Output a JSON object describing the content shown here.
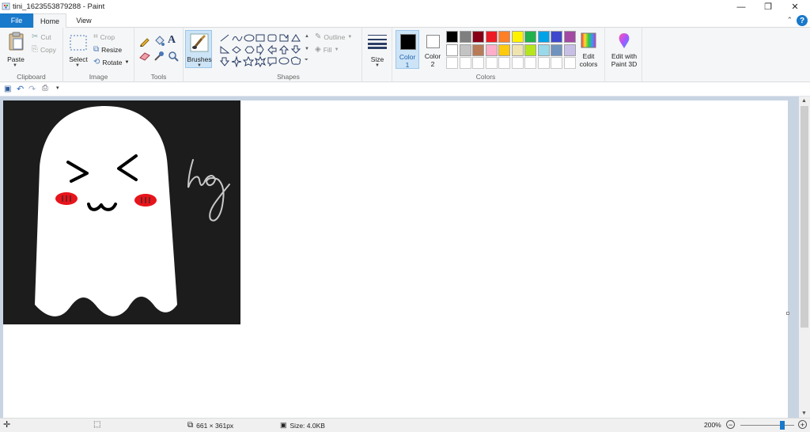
{
  "window": {
    "title": "tini_1623553879288 - Paint",
    "minimize": "—",
    "restore": "❐",
    "close": "✕"
  },
  "tabs": [
    {
      "label": "File"
    },
    {
      "label": "Home"
    },
    {
      "label": "View"
    }
  ],
  "help": "?",
  "ribbon": {
    "clipboard": {
      "label": "Clipboard",
      "paste": "Paste",
      "cut": "Cut",
      "copy": "Copy"
    },
    "image": {
      "label": "Image",
      "select": "Select",
      "crop": "Crop",
      "resize": "Resize",
      "rotate": "Rotate"
    },
    "tools": {
      "label": "Tools"
    },
    "brushes": {
      "label": "Brushes"
    },
    "shapes": {
      "label": "Shapes",
      "outline": "Outline",
      "fill": "Fill"
    },
    "size": {
      "label": "Size"
    },
    "colors": {
      "label": "Colors",
      "color1": "Color\n1",
      "color1_line1": "Color",
      "color1_line2": "1",
      "color2_line1": "Color",
      "color2_line2": "2",
      "edit_colors_line1": "Edit",
      "edit_colors_line2": "colors",
      "paint3d_line1": "Edit with",
      "paint3d_line2": "Paint 3D",
      "active_color1": "#000000",
      "active_color2": "#ffffff",
      "palette_row1": [
        "#000000",
        "#7f7f7f",
        "#880015",
        "#ed1c24",
        "#ff7f27",
        "#fff200",
        "#22b14c",
        "#00a2e8",
        "#3f48cc",
        "#a349a4"
      ],
      "palette_row2": [
        "#ffffff",
        "#c3c3c3",
        "#b97a57",
        "#ffaec9",
        "#ffc90e",
        "#efe4b0",
        "#b5e61d",
        "#99d9ea",
        "#7092be",
        "#c8bfe7"
      ],
      "palette_row3": [
        "#ffffff",
        "#ffffff",
        "#ffffff",
        "#ffffff",
        "#ffffff",
        "#ffffff",
        "#ffffff",
        "#ffffff",
        "#ffffff",
        "#ffffff"
      ]
    }
  },
  "status": {
    "dimensions": "661 × 361px",
    "size": "Size: 4.0KB",
    "zoom": "200%",
    "zoom_level": 0.8
  },
  "image": {
    "background": "#1c1c1c",
    "ghost_color": "#ffffff",
    "blush_color": "#e8141b",
    "signature": "hg"
  }
}
